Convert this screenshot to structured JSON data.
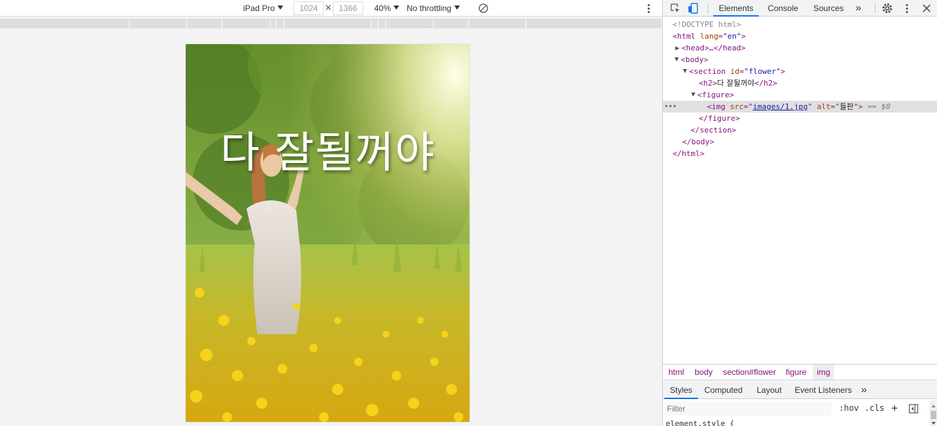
{
  "device_toolbar": {
    "device": "iPad Pro",
    "width": "1024",
    "height": "1366",
    "times": "×",
    "zoom": "40%",
    "throttling": "No throttling"
  },
  "page": {
    "headline": "다 잘될꺼야"
  },
  "devtools": {
    "tabs": [
      "Elements",
      "Console",
      "Sources"
    ],
    "more": "»",
    "active_tab": "Elements",
    "tree": {
      "doctype": "<!DOCTYPE html>",
      "html_open": "<html",
      "lang_attr": "lang",
      "lang_val": "\"en\"",
      "head": "<head>…</head>",
      "body_open": "<body>",
      "section_open": "<section",
      "id_attr": "id",
      "id_val": "\"flower\"",
      "h2_open": "<h2>",
      "h2_text": "다 잘될꺼야",
      "h2_close": "</h2>",
      "figure_open": "<figure>",
      "img_open": "<img",
      "src_attr": "src",
      "src_val": "images/1.jpg",
      "alt_attr": "alt",
      "alt_val": "들판",
      "eq_marker": "== $0",
      "figure_close": "</figure>",
      "section_close": "</section>",
      "body_close": "</body>",
      "html_close": "</html>",
      "ellipsis": "•••"
    },
    "breadcrumbs": [
      "html",
      "body",
      "section#flower",
      "figure",
      "img"
    ],
    "sub_tabs": [
      "Styles",
      "Computed",
      "Layout",
      "Event Listeners"
    ],
    "sub_more": "»",
    "filter_placeholder": "Filter",
    "hov": ":hov",
    "cls": ".cls",
    "plus": "+",
    "styles_preview": "element.style {"
  }
}
